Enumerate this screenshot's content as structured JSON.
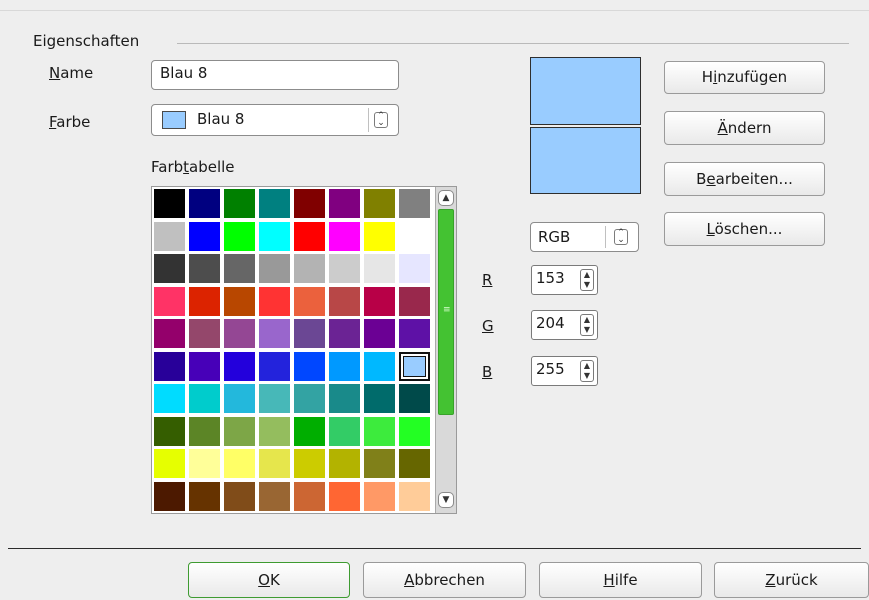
{
  "group": {
    "title": "Eigenschaften"
  },
  "name_field": {
    "label_pre": "",
    "label_u": "N",
    "label_post": "ame",
    "value": "Blau 8"
  },
  "color_field": {
    "label_pre": "",
    "label_u": "F",
    "label_post": "arbe",
    "value": "Blau 8",
    "swatch": "#99ccff"
  },
  "table": {
    "label_pre": "Farb",
    "label_u": "t",
    "label_post": "abelle"
  },
  "palette": [
    [
      "#000000",
      "#000080",
      "#008000",
      "#008080",
      "#800000",
      "#800080",
      "#808000",
      "#808080"
    ],
    [
      "#c0c0c0",
      "#0000ff",
      "#00ff00",
      "#00ffff",
      "#ff0000",
      "#ff00ff",
      "#ffff00",
      "#ffffff"
    ],
    [
      "#333333",
      "#4d4d4d",
      "#666666",
      "#999999",
      "#b3b3b3",
      "#cccccc",
      "#e6e6e6",
      "#e6e6ff"
    ],
    [
      "#ff3366",
      "#dc2300",
      "#b84700",
      "#ff3333",
      "#eb613d",
      "#b84747",
      "#b80047",
      "#99284c"
    ],
    [
      "#94006b",
      "#94476b",
      "#944794",
      "#9966cc",
      "#6b4794",
      "#6b2394",
      "#6b0094",
      "#5e11a6"
    ],
    [
      "#280099",
      "#4700b8",
      "#2300dc",
      "#2323dc",
      "#0047ff",
      "#0099ff",
      "#00b8ff",
      "#99ccff"
    ],
    [
      "#00dcff",
      "#00cccc",
      "#23b8dc",
      "#47b8b8",
      "#33a3a3",
      "#198a8a",
      "#006b6b",
      "#004a4a"
    ],
    [
      "#355e00",
      "#5c8526",
      "#7da647",
      "#94bd5e",
      "#00ae00",
      "#33cc66",
      "#3deb3d",
      "#23ff23"
    ],
    [
      "#e6ff00",
      "#ffff99",
      "#ffff66",
      "#e6e64c",
      "#cccc00",
      "#b3b300",
      "#808019",
      "#666600"
    ],
    [
      "#4c1900",
      "#663300",
      "#804c19",
      "#996633",
      "#cc6633",
      "#ff6633",
      "#ff9966",
      "#ffcc99"
    ]
  ],
  "selected_cell": {
    "row": 5,
    "col": 7
  },
  "preview": {
    "old_color": "#99ccff",
    "new_color": "#99ccff"
  },
  "model_select": {
    "value": "RGB"
  },
  "rgb": [
    {
      "label": "R",
      "value": "153"
    },
    {
      "label": "G",
      "value": "204"
    },
    {
      "label": "B",
      "value": "255"
    }
  ],
  "side_buttons": {
    "add": {
      "pre": "H",
      "u": "i",
      "post": "nzufügen"
    },
    "change": {
      "pre": "",
      "u": "Ä",
      "post": "ndern"
    },
    "edit": {
      "pre": "B",
      "u": "e",
      "post": "arbeiten..."
    },
    "delete": {
      "pre": "",
      "u": "L",
      "post": "öschen..."
    }
  },
  "bottom_buttons": {
    "ok": {
      "pre": "",
      "u": "O",
      "post": "K"
    },
    "cancel": {
      "pre": "",
      "u": "A",
      "post": "bbrechen"
    },
    "help": {
      "pre": "",
      "u": "H",
      "post": "ilfe"
    },
    "reset": {
      "pre": "",
      "u": "Z",
      "post": "urück"
    }
  },
  "colors": {
    "scroll_thumb": "#44c232",
    "ok_border": "#3e9b31"
  }
}
